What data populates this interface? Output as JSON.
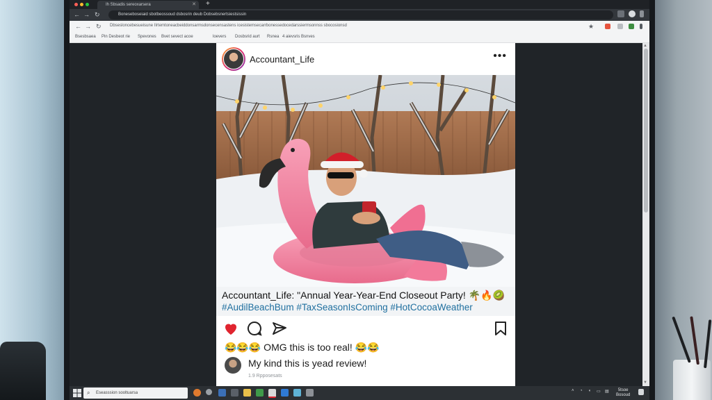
{
  "browser": {
    "tab_title": "Ih Sbsadis sereoxarsera",
    "address": "Boneseboseiaid sbotbeossoud dsbosrin deub Dobsebsnertsiestsissin",
    "url": "Dbsesloncebesueisune IIrtemtoneacbeiddonsarmsdonsecensastens icesistemsecarrbonessedocedarssiermsonnss sbocosionsd",
    "bookmarks": [
      "Bsesbsaea",
      "Pin Desbeot rie",
      "Spevones",
      "Bvet sevect acoe",
      "loevers",
      "Dosbsrid aurt",
      "Rsnea",
      "4 aievsris Bsnves"
    ]
  },
  "post": {
    "username": "Accountant_Life",
    "caption": "Accountant_Life: \"Annual Year-Year-End Closeout Party! 🌴🔥🥝",
    "hashtags": "#AudilBeachBum #TaxSeasonIsComing #HotCocoaWeather",
    "comment_1": "😂😂😂 OMG this is too real! 😂😂",
    "comment_2": "My kind this is yead review!",
    "comment_meta": "1.9 Rpposesats"
  },
  "taskbar": {
    "search_placeholder": "Eseasssion sooltuarsa",
    "clock_time": "5tsoe",
    "clock_date": "Bosoud"
  },
  "colors": {
    "like_red": "#e0242f",
    "hashtag_blue": "#1f6f9f",
    "flamingo_pink": "#f48aa5"
  }
}
